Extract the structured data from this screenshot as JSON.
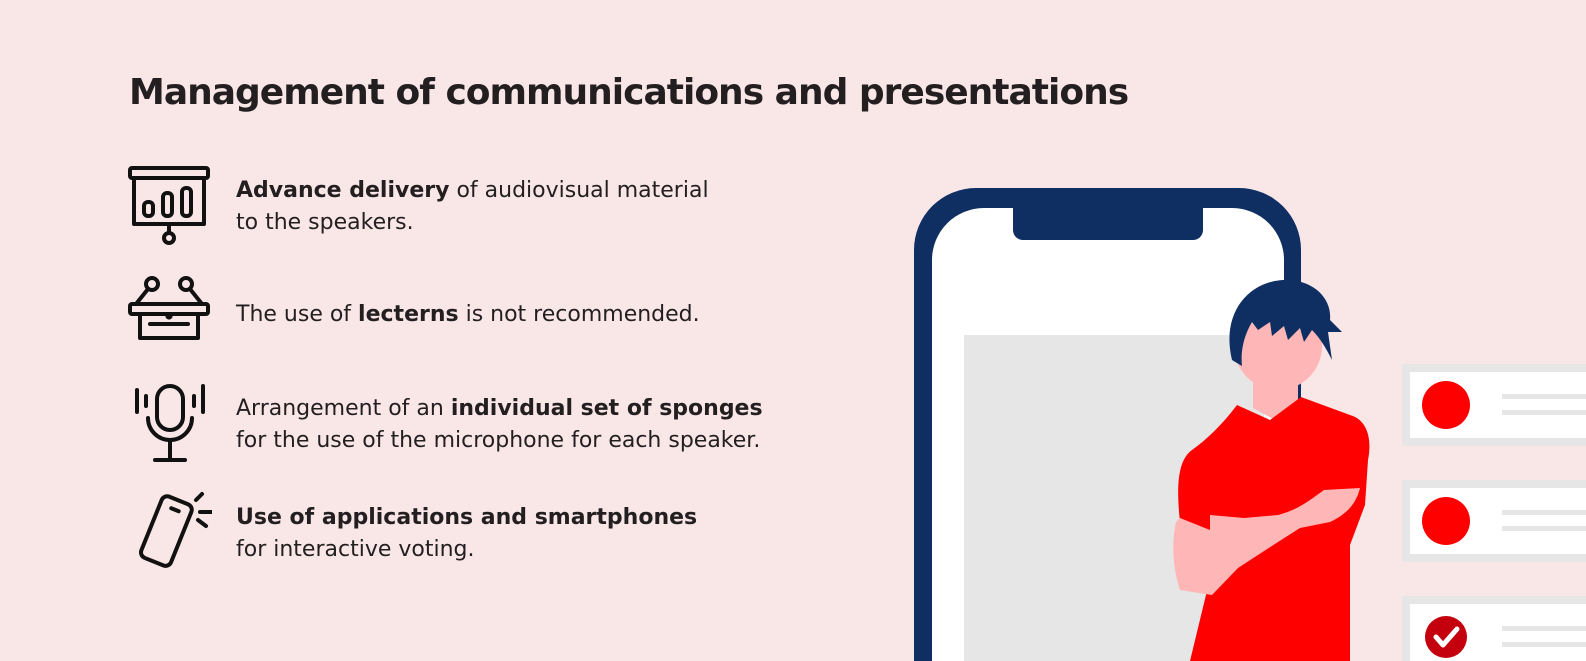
{
  "title": "Management of communications and presentations",
  "items": [
    {
      "icon": "presentation-board-icon",
      "bold": "Advance delivery",
      "after": " of audiovisual material",
      "line2": "to the speakers."
    },
    {
      "icon": "lectern-icon",
      "before": "The use of ",
      "bold": "lecterns",
      "after": " is not recommended."
    },
    {
      "icon": "microphone-icon",
      "before": "Arrangement of an ",
      "bold": "individual set of sponges",
      "line2": "for the use of the microphone for each speaker."
    },
    {
      "icon": "smartphone-icon",
      "bold": "Use of applications and smartphones",
      "line2": "for interactive voting."
    }
  ],
  "colors": {
    "background": "#f9e6e7",
    "phone_frame": "#0f2f63",
    "accent_red": "#ff0000",
    "skin": "#ffb6b6",
    "text": "#231f20"
  }
}
